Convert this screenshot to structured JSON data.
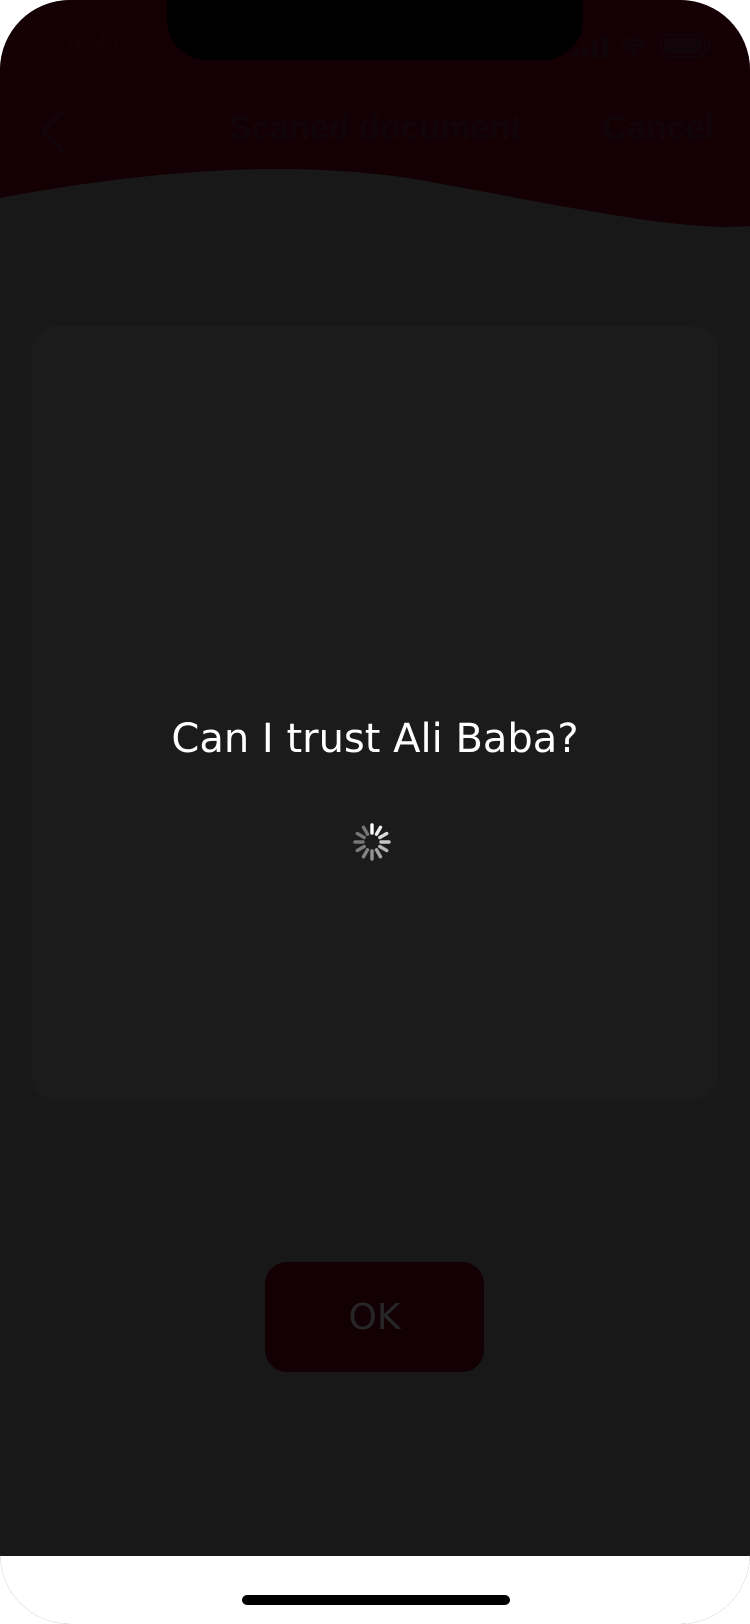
{
  "status_bar": {
    "time": "9:41",
    "icons": [
      "cellular-signal-icon",
      "wifi-icon",
      "battery-icon"
    ]
  },
  "nav": {
    "back_icon": "chevron-left-icon",
    "title": "Scaned document",
    "cancel_label": "Cancel"
  },
  "loading": {
    "message": "Can I trust Ali Baba?",
    "spinner_icon": "activity-spinner-icon"
  },
  "actions": {
    "ok_label": "OK"
  },
  "colors": {
    "background": "#181818",
    "header": "#140004",
    "card": "#1b1b1b",
    "ok_button": "#130004",
    "text_primary": "#ffffff"
  }
}
